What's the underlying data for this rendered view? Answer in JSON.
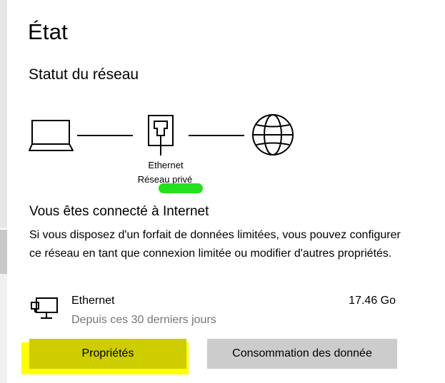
{
  "page": {
    "title": "État",
    "section_title": "Statut du réseau"
  },
  "network_diagram": {
    "adapter_name": "Ethernet",
    "network_profile": "Réseau privé",
    "icons": [
      "laptop-icon",
      "ethernet-port-icon",
      "globe-icon"
    ]
  },
  "connection": {
    "title": "Vous êtes connecté à Internet",
    "description": "Si vous disposez d'un forfait de données limitées, vous pouvez configurer ce réseau en tant que connexion limitée ou modifier d'autres propriétés."
  },
  "data_usage": {
    "name": "Ethernet",
    "period": "Depuis ces 30 derniers jours",
    "amount": "17.46 Go",
    "icon": "wired-network-icon"
  },
  "buttons": {
    "properties_label": "Propriétés",
    "data_usage_label": "Consommation des donnée"
  },
  "colors": {
    "highlight_yellow": "#ffff00",
    "highlight_green": "#25e01e",
    "button_gray": "#cccccc",
    "secondary_text": "#767676"
  }
}
